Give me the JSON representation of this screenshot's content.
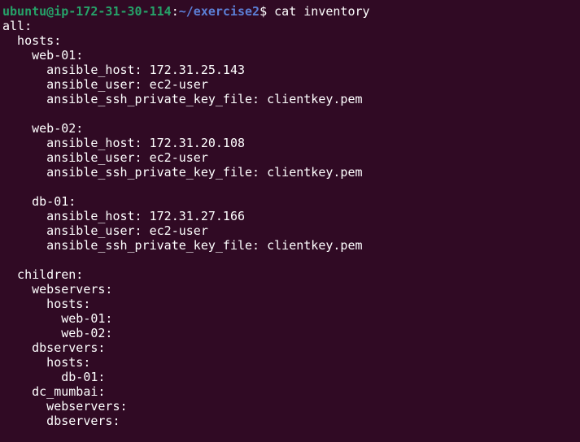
{
  "colors": {
    "background": "#300a24",
    "foreground": "#ffffff",
    "prompt_user": "#26a269",
    "prompt_path": "#5c7fd6"
  },
  "prompt": {
    "user_host": "ubuntu@ip-172-31-30-114",
    "separator": ":",
    "path": "~/exercise2",
    "symbol": "$",
    "command": " cat inventory"
  },
  "output_lines": [
    "all:",
    "  hosts:",
    "    web-01:",
    "      ansible_host: 172.31.25.143",
    "      ansible_user: ec2-user",
    "      ansible_ssh_private_key_file: clientkey.pem",
    "",
    "    web-02:",
    "      ansible_host: 172.31.20.108",
    "      ansible_user: ec2-user",
    "      ansible_ssh_private_key_file: clientkey.pem",
    "",
    "    db-01:",
    "      ansible_host: 172.31.27.166",
    "      ansible_user: ec2-user",
    "      ansible_ssh_private_key_file: clientkey.pem",
    "",
    "  children:",
    "    webservers:",
    "      hosts:",
    "        web-01:",
    "        web-02:",
    "    dbservers:",
    "      hosts:",
    "        db-01:",
    "    dc_mumbai:",
    "      webservers:",
    "      dbservers:"
  ]
}
